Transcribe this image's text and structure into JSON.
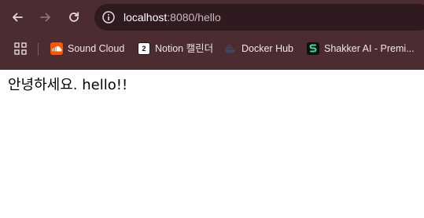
{
  "toolbar": {
    "back_icon": "arrow-left-icon",
    "forward_icon": "arrow-right-icon",
    "reload_icon": "reload-icon"
  },
  "address_bar": {
    "host": "localhost",
    "path": ":8080/hello",
    "security_icon": "info-icon"
  },
  "bookmarks": [
    {
      "label": "Sound Cloud",
      "icon": "soundcloud-icon"
    },
    {
      "label": "Notion 캘린더",
      "icon": "notion-calendar-icon",
      "badge": "2"
    },
    {
      "label": "Docker Hub",
      "icon": "docker-icon"
    },
    {
      "label": "Shakker AI - Premi...",
      "icon": "shakker-icon"
    }
  ],
  "page": {
    "body_text": "안녕하세요. hello!!"
  },
  "colors": {
    "chrome_bg": "#4a2c31",
    "omnibox_bg": "#2f1b1f",
    "soundcloud": "#ff5500",
    "shakker_accent": "#3ee08f",
    "docker_accent": "#3a4a5c"
  }
}
